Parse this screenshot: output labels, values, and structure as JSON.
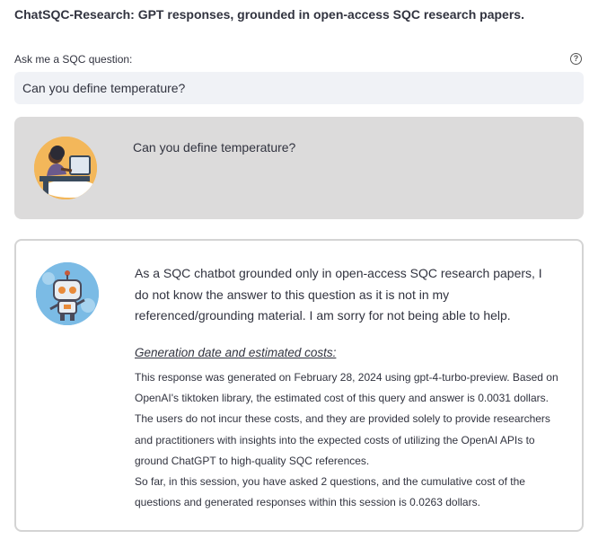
{
  "header": {
    "title": "ChatSQC-Research: GPT responses, grounded in open-access SQC research papers."
  },
  "question_input": {
    "label": "Ask me a SQC question:",
    "value": "Can you define temperature?",
    "help_icon": "question-circle-icon"
  },
  "chat": {
    "user_message": {
      "avatar_icon": "person-at-laptop-avatar",
      "text": "Can you define temperature?"
    },
    "bot_message": {
      "avatar_icon": "robot-avatar",
      "answer": "As a SQC chatbot grounded only in open-access SQC research papers, I do not know the answer to this question as it is not in my referenced/grounding material. I am sorry for not being able to help.",
      "generation_heading": "Generation date and estimated costs:",
      "generation_paragraph_1": "This response was generated on February 28, 2024 using gpt-4-turbo-preview. Based on OpenAI's tiktoken library, the estimated cost of this query and answer is 0.0031 dollars. The users do not incur these costs, and they are provided solely to provide researchers and practitioners with insights into the expected costs of utilizing the OpenAI APIs to ground ChatGPT to high-quality SQC references.",
      "generation_paragraph_2": "So far, in this session, you have asked 2 questions, and the cumulative cost of the questions and generated responses within this session is 0.0263 dollars."
    }
  },
  "colors": {
    "input_bg": "#f0f2f6",
    "user_msg_bg": "#dcdbdb",
    "bot_msg_border": "#d4d4d4",
    "text": "#31333f"
  }
}
